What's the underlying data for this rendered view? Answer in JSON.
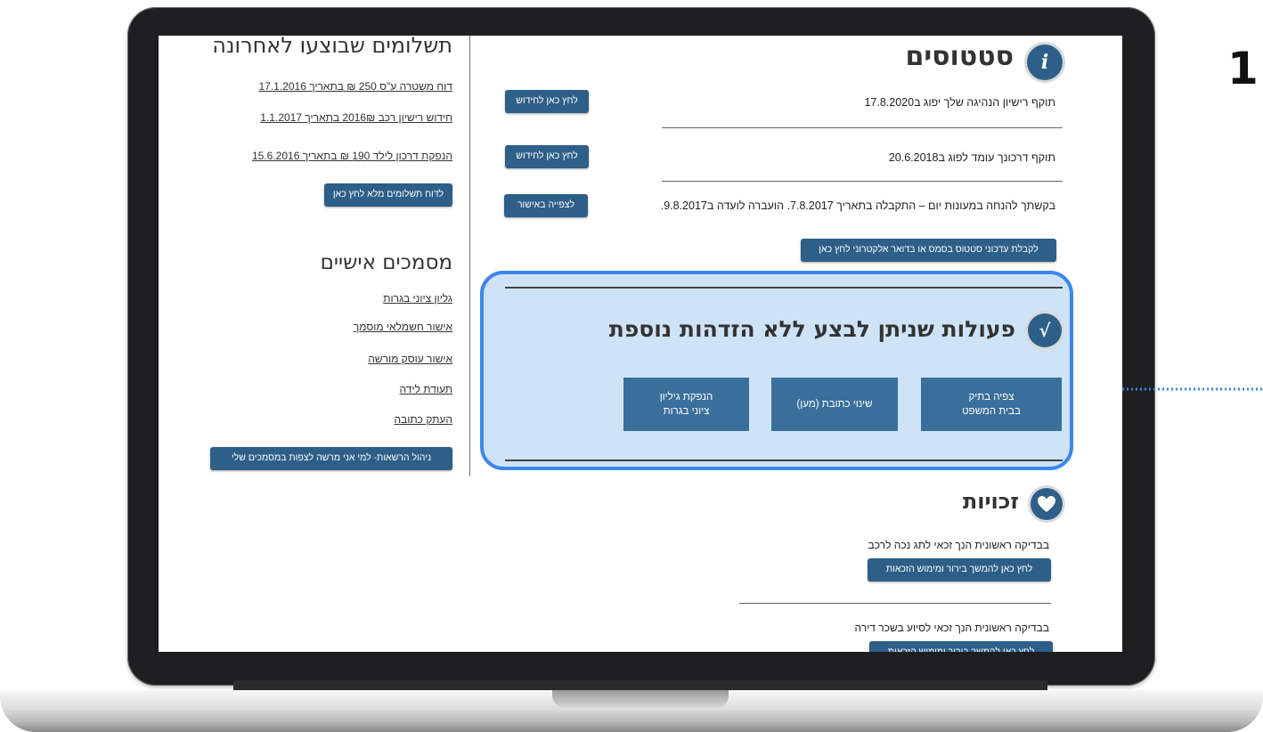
{
  "edge_label": "1",
  "status": {
    "title": "סטטוסים",
    "icon_letter": "i",
    "rows": [
      {
        "text": "תוקף רישיון הנהיגה שלך יפוג ב17.8.2020",
        "button": "לחץ כאן לחידוש"
      },
      {
        "text": "תוקף דרכונך עומד לפוג ב20.6.2018",
        "button": "לחץ כאן לחידוש"
      },
      {
        "text": "בקשתך להנחה במעונות יום – התקבלה בתאריך 7.8.2017. הועברה לועדה ב9.8.2017.",
        "button": "לצפייה באישור"
      }
    ],
    "updates_button": "לקבלת עדכוני סטטוס בסמס או בדואר אלקטרוני לחץ כאן"
  },
  "actions": {
    "title": "פעולות שניתן לבצע ללא הזדהות נוספת",
    "icon_letter": "√",
    "buttons": [
      {
        "line1": "צפיה בתיק",
        "line2": "בבית המשפט"
      },
      {
        "line1": "שינוי כתובת (מען)",
        "line2": ""
      },
      {
        "line1": "הנפקת גיליון",
        "line2": "ציוני בגרות"
      }
    ]
  },
  "rights": {
    "title": "זכויות",
    "icon": "heart-icon",
    "items": [
      {
        "text": "בבדיקה ראשונית הנך זכאי לתג נכה לרכב",
        "button": "לחץ כאן להמשך בירור ומימוש הזכאות"
      },
      {
        "text": "בבדיקה ראשונית הנך זכאי לסיוע בשכר דירה",
        "button": "לחץ כאן להמשך בירור ומימוש הזכאות"
      }
    ]
  },
  "payments": {
    "title": "תשלומים שבוצעו לאחרונה",
    "links": [
      "דוח משטרה ע\"ס 250 ₪ בתאריך 17.1.2016",
      "חידוש רישיון רכב 2016₪ בתאריך 1.1.2017",
      "הנפקת דרכון לילד 190 ₪ בתאריך 15.6.2016"
    ],
    "report_button": "לדוח תשלומים מלא לחץ כאן"
  },
  "documents": {
    "title": "מסמכים אישיים",
    "links": [
      "גליון ציוני בגרות",
      "אישור חשמלאי מוסמך",
      "אישור עוסק מורשה",
      "תעודת לידה",
      "העתק כתובה"
    ],
    "permissions_button": "ניהול הרשאות- למי אני מרשה לצפות במסמכים שלי"
  },
  "colors": {
    "button": "#2d5f88",
    "highlight_fill": "#cfe3f7",
    "highlight_border": "#3b86f0",
    "arrow": "#3b86f0"
  }
}
